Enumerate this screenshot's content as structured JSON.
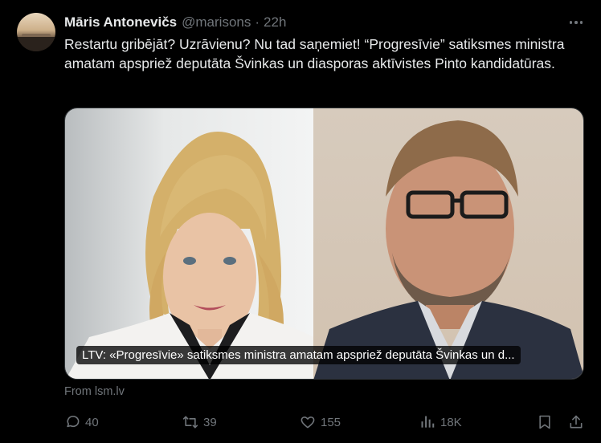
{
  "tweet": {
    "author_name": "Māris Antonevičs",
    "handle": "@marisons",
    "separator": "·",
    "time": "22h",
    "text": "Restartu gribējāt? Uzrāvienu? Nu tad saņemiet! “Progresīvie” satiksmes ministra amatam apspriež deputāta Švinkas un diasporas aktīvistes Pinto kandidatūras."
  },
  "card": {
    "caption": "LTV: «Progresīvie» satiksmes ministra amatam apspriež deputāta Švinkas un d...",
    "source": "From lsm.lv"
  },
  "actions": {
    "reply_count": "40",
    "repost_count": "39",
    "like_count": "155",
    "views_count": "18K"
  },
  "icons": {
    "more": "more-icon",
    "reply": "reply-icon",
    "repost": "repost-icon",
    "like": "heart-icon",
    "views": "views-icon",
    "bookmark": "bookmark-icon",
    "share": "share-icon"
  },
  "colors": {
    "background": "#000000",
    "text": "#e7e9ea",
    "muted": "#71767b",
    "border": "#2f3336"
  }
}
